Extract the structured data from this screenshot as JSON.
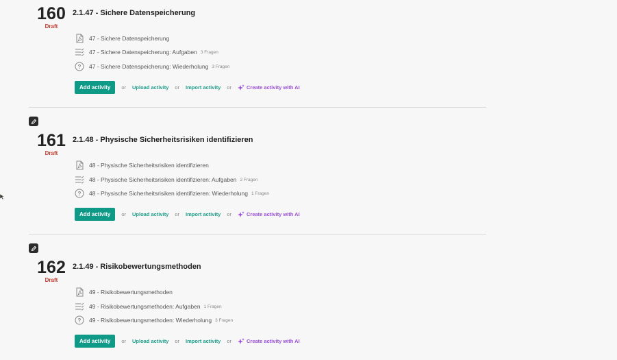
{
  "common": {
    "draft_label": "Draft",
    "add_activity": "Add activity",
    "or": "or",
    "upload_activity": "Upload activity",
    "import_activity": "Import activity",
    "create_ai": "Create activity with AI"
  },
  "lessons": [
    {
      "number": "160",
      "title": "2.1.47 - Sichere Datenspeicherung",
      "activities": [
        {
          "icon": "pdf-icon",
          "name": "47 - Sichere Datenspeicherung",
          "count": ""
        },
        {
          "icon": "quiz-list-icon",
          "name": "47 - Sichere Datenspeicherung: Aufgaben",
          "count": "3 Fragen"
        },
        {
          "icon": "question-icon",
          "name": "47 - Sichere Datenspeicherung: Wiederholung",
          "count": "3 Fragen"
        }
      ]
    },
    {
      "number": "161",
      "title": "2.1.48 - Physische Sicherheitsrisiken identifizieren",
      "activities": [
        {
          "icon": "pdf-icon",
          "name": "48 - Physische Sicherheitsrisiken identifizieren",
          "count": ""
        },
        {
          "icon": "quiz-list-icon",
          "name": "48 - Physische Sicherheitsrisiken identifizieren: Aufgaben",
          "count": "2 Fragen"
        },
        {
          "icon": "question-icon",
          "name": "48 - Physische Sicherheitsrisiken identifizieren: Wiederholung",
          "count": "1 Fragen"
        }
      ]
    },
    {
      "number": "162",
      "title": "2.1.49 - Risikobewertungsmethoden",
      "activities": [
        {
          "icon": "pdf-icon",
          "name": "49 - Risikobewertungsmethoden",
          "count": ""
        },
        {
          "icon": "quiz-list-icon",
          "name": "49 - Risikobewertungsmethoden: Aufgaben",
          "count": "1 Fragen"
        },
        {
          "icon": "question-icon",
          "name": "49 - Risikobewertungsmethoden: Wiederholung",
          "count": "3 Fragen"
        }
      ]
    }
  ]
}
